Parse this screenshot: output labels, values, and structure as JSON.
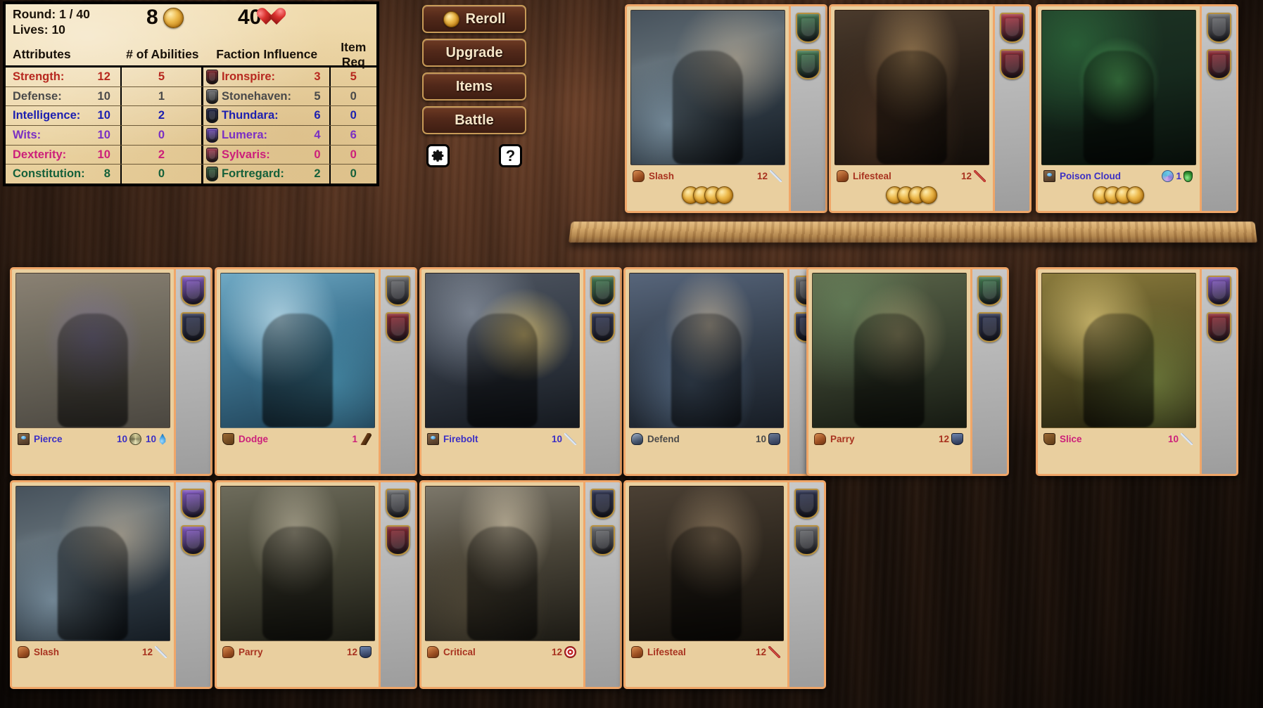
{
  "status": {
    "round_label": "Round: 1 / 40",
    "lives_label": "Lives: 10",
    "gold": "8",
    "health": "40"
  },
  "table": {
    "headers": {
      "attributes": "Attributes",
      "abilities": "# of Abilities",
      "faction": "Faction Influence",
      "item_req": "Item Req"
    },
    "rows": [
      {
        "attr": "Strength:",
        "attr_value": "12",
        "abilities": "5",
        "faction": "Ironspire:",
        "faction_value": "3",
        "item_req": "5",
        "color": "#b7281f",
        "crest": "#7d2026"
      },
      {
        "attr": "Defense:",
        "attr_value": "10",
        "abilities": "1",
        "faction": "Stonehaven:",
        "faction_value": "5",
        "item_req": "0",
        "color": "#4a4a4a",
        "crest": "#6d6f72"
      },
      {
        "attr": "Intelligence:",
        "attr_value": "10",
        "abilities": "2",
        "faction": "Thundara:",
        "faction_value": "6",
        "item_req": "0",
        "color": "#1c1fb0",
        "crest": "#1b1f40"
      },
      {
        "attr": "Wits:",
        "attr_value": "10",
        "abilities": "0",
        "faction": "Lumera:",
        "faction_value": "4",
        "item_req": "6",
        "color": "#7a2fc4",
        "crest": "#6c46b8"
      },
      {
        "attr": "Dexterity:",
        "attr_value": "10",
        "abilities": "2",
        "faction": "Sylvaris:",
        "faction_value": "0",
        "item_req": "0",
        "color": "#cc1f7a",
        "crest": "#a5384f"
      },
      {
        "attr": "Constitution:",
        "attr_value": "8",
        "abilities": "0",
        "faction": "Fortregard:",
        "faction_value": "2",
        "item_req": "0",
        "color": "#15603a",
        "crest": "#2f5b38"
      }
    ]
  },
  "buttons": {
    "reroll": "Reroll",
    "upgrade": "Upgrade",
    "items": "Items",
    "battle": "Battle",
    "settings_icon": "gear-icon",
    "help_icon": "question-mark-icon",
    "help_label": "?"
  },
  "shop_cards": [
    {
      "name": "Slash",
      "name_color": "#a8321f",
      "type_icon": "arm-icon",
      "type_icon_class": "ic-arm",
      "stats": [
        {
          "value": "12",
          "icon": "sword-icon",
          "icon_class": "ic-sword"
        }
      ],
      "cost_coins": 4,
      "art_class": "art-warrior-ice",
      "crests": [
        "#3f7a4e",
        "#3f7a4e"
      ]
    },
    {
      "name": "Lifesteal",
      "name_color": "#a8321f",
      "type_icon": "arm-icon",
      "type_icon_class": "ic-arm",
      "stats": [
        {
          "value": "12",
          "icon": "red-sword-icon",
          "icon_class": "ic-sword-red"
        }
      ],
      "cost_coins": 4,
      "art_class": "art-rogue-night",
      "crests": [
        "#b03040",
        "#8f2430"
      ]
    },
    {
      "name": "Poison Cloud",
      "name_color": "#3b2fc4",
      "type_icon": "book-icon",
      "type_icon_class": "ic-book",
      "stats": [
        {
          "value": "1",
          "icon": "orb-icon",
          "icon_class": "ic-orb",
          "icon_first": true,
          "tail_icon": "potion-icon",
          "tail_icon_class": "ic-potion"
        }
      ],
      "cost_coins": 4,
      "art_class": "art-potion-swamp",
      "crests": [
        "#6d6f72",
        "#8f2430"
      ]
    }
  ],
  "owned_rows": [
    [
      {
        "name": "Pierce",
        "name_color": "#3b2fc4",
        "type_icon": "book-icon",
        "type_icon_class": "ic-book",
        "stats": [
          {
            "value": "10",
            "icon": "spiral-icon",
            "icon_class": "ic-spiral"
          },
          {
            "value": "10",
            "icon": "water-drop-icon",
            "icon_class": "ic-drop"
          }
        ],
        "art_class": "art-armor-set",
        "crests": [
          "#8355c9",
          "#2b3150"
        ]
      },
      {
        "name": "Dodge",
        "name_color": "#cc1f7a",
        "type_icon": "boot-icon",
        "type_icon_class": "ic-boot",
        "stats": [
          {
            "value": "1",
            "icon": "dodge-icon",
            "icon_class": "ic-dodge"
          }
        ],
        "art_class": "art-rogue-leap",
        "crests": [
          "#6d6f72",
          "#8f2430"
        ]
      },
      {
        "name": "Firebolt",
        "name_color": "#3b2fc4",
        "type_icon": "book-icon",
        "type_icon_class": "ic-book",
        "stats": [
          {
            "value": "10",
            "icon": "sword-icon",
            "icon_class": "ic-sword"
          }
        ],
        "art_class": "art-wizard",
        "crests": [
          "#3f7a4e",
          "#2b3150"
        ]
      },
      {
        "name": "Defend",
        "name_color": "#4a4a4a",
        "type_icon": "helm-icon",
        "type_icon_class": "ic-helm",
        "stats": [
          {
            "value": "10",
            "icon": "armor-icon",
            "icon_class": "ic-armor"
          }
        ],
        "art_class": "art-knight-shout",
        "crests": [
          "#6d6f72",
          "#2b3150"
        ]
      },
      {
        "name": "Parry",
        "name_color": "#a8321f",
        "type_icon": "arm-icon",
        "type_icon_class": "ic-arm",
        "stats": [
          {
            "value": "12",
            "icon": "shield-icon",
            "icon_class": "ic-shield"
          }
        ],
        "art_class": "art-shield-forest",
        "crests": [
          "#3f7a4e",
          "#2b3150"
        ]
      },
      {
        "name": "Slice",
        "name_color": "#cc1f7a",
        "type_icon": "boot-icon",
        "type_icon_class": "ic-boot",
        "stats": [
          {
            "value": "10",
            "icon": "sword-icon",
            "icon_class": "ic-sword"
          }
        ],
        "art_class": "art-archer-forest",
        "crests": [
          "#8355c9",
          "#8f2430"
        ]
      }
    ],
    [
      {
        "name": "Slash",
        "name_color": "#a8321f",
        "type_icon": "arm-icon",
        "type_icon_class": "ic-arm",
        "stats": [
          {
            "value": "12",
            "icon": "sword-icon",
            "icon_class": "ic-sword"
          }
        ],
        "art_class": "art-warrior-ice",
        "crests": [
          "#8355c9",
          "#8355c9"
        ]
      },
      {
        "name": "Parry",
        "name_color": "#a8321f",
        "type_icon": "arm-icon",
        "type_icon_class": "ic-arm",
        "stats": [
          {
            "value": "12",
            "icon": "shield-icon",
            "icon_class": "ic-shield"
          }
        ],
        "art_class": "art-warrior-field",
        "crests": [
          "#6d6f72",
          "#8f2430"
        ]
      },
      {
        "name": "Critical",
        "name_color": "#a8321f",
        "type_icon": "arm-icon",
        "type_icon_class": "ic-arm",
        "stats": [
          {
            "value": "12",
            "icon": "target-icon",
            "icon_class": "ic-target"
          }
        ],
        "art_class": "art-swordsman-dusk",
        "crests": [
          "#2b3150",
          "#6d6f72"
        ]
      },
      {
        "name": "Lifesteal",
        "name_color": "#a8321f",
        "type_icon": "arm-icon",
        "type_icon_class": "ic-arm",
        "stats": [
          {
            "value": "12",
            "icon": "red-sword-icon",
            "icon_class": "ic-sword-red"
          }
        ],
        "art_class": "art-duelist-dark",
        "crests": [
          "#2b3150",
          "#6d6f72"
        ]
      }
    ]
  ]
}
